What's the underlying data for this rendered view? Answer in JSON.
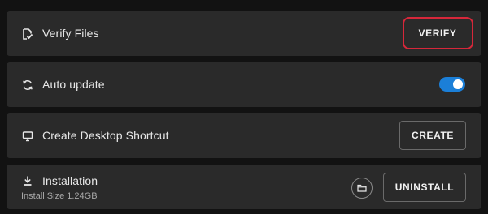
{
  "rows": [
    {
      "icon": "verify-file-icon",
      "label": "Verify Files",
      "button_label": "VERIFY"
    },
    {
      "icon": "refresh-icon",
      "label": "Auto update",
      "toggle_on": true
    },
    {
      "icon": "monitor-icon",
      "label": "Create Desktop Shortcut",
      "button_label": "CREATE"
    },
    {
      "icon": "download-icon",
      "label": "Installation",
      "sublabel": "Install Size 1.24GB",
      "folder_icon": "folder-icon",
      "button_label": "UNINSTALL"
    }
  ],
  "colors": {
    "background": "#121212",
    "row_background": "#2a2a2a",
    "toggle_on": "#1b7fd8",
    "highlight": "#d6273a"
  }
}
